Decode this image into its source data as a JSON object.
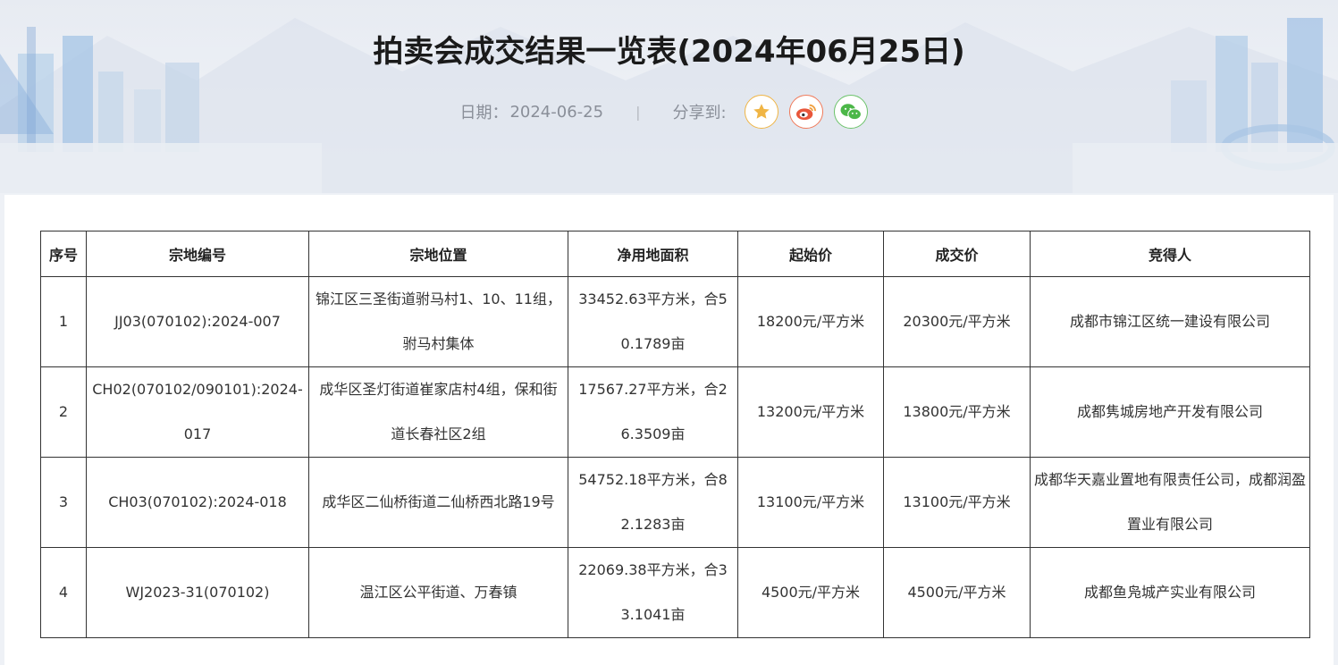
{
  "header": {
    "title": "拍卖会成交结果一览表(2024年06月25日)",
    "date_label": "日期：",
    "date_value": "2024-06-25",
    "divider": "|",
    "share_label": "分享到:",
    "share_buttons": [
      {
        "icon": "star-icon",
        "color": "#f0b545"
      },
      {
        "icon": "weibo-icon",
        "color": "#e8563a"
      },
      {
        "icon": "wechat-icon",
        "color": "#4cb748"
      }
    ]
  },
  "table": {
    "headers": [
      "序号",
      "宗地编号",
      "宗地位置",
      "净用地面积",
      "起始价",
      "成交价",
      "竞得人"
    ],
    "rows": [
      [
        "1",
        "JJ03(070102):2024-007",
        "锦江区三圣街道驸马村1、10、11组，驸马村集体",
        "33452.63平方米，合50.1789亩",
        "18200元/平方米",
        "20300元/平方米",
        "成都市锦江区统一建设有限公司"
      ],
      [
        "2",
        "CH02(070102/090101):2024-017",
        "成华区圣灯街道崔家店村4组，保和街道长春社区2组",
        "17567.27平方米，合26.3509亩",
        "13200元/平方米",
        "13800元/平方米",
        "成都隽城房地产开发有限公司"
      ],
      [
        "3",
        "CH03(070102):2024-018",
        "成华区二仙桥街道二仙桥西北路19号",
        "54752.18平方米，合82.1283亩",
        "13100元/平方米",
        "13100元/平方米",
        "成都华天嘉业置地有限责任公司，成都润盈置业有限公司"
      ],
      [
        "4",
        "WJ2023-31(070102)",
        "温江区公平街道、万春镇",
        "22069.38平方米，合33.1041亩",
        "4500元/平方米",
        "4500元/平方米",
        "成都鱼凫城产实业有限公司"
      ]
    ]
  }
}
